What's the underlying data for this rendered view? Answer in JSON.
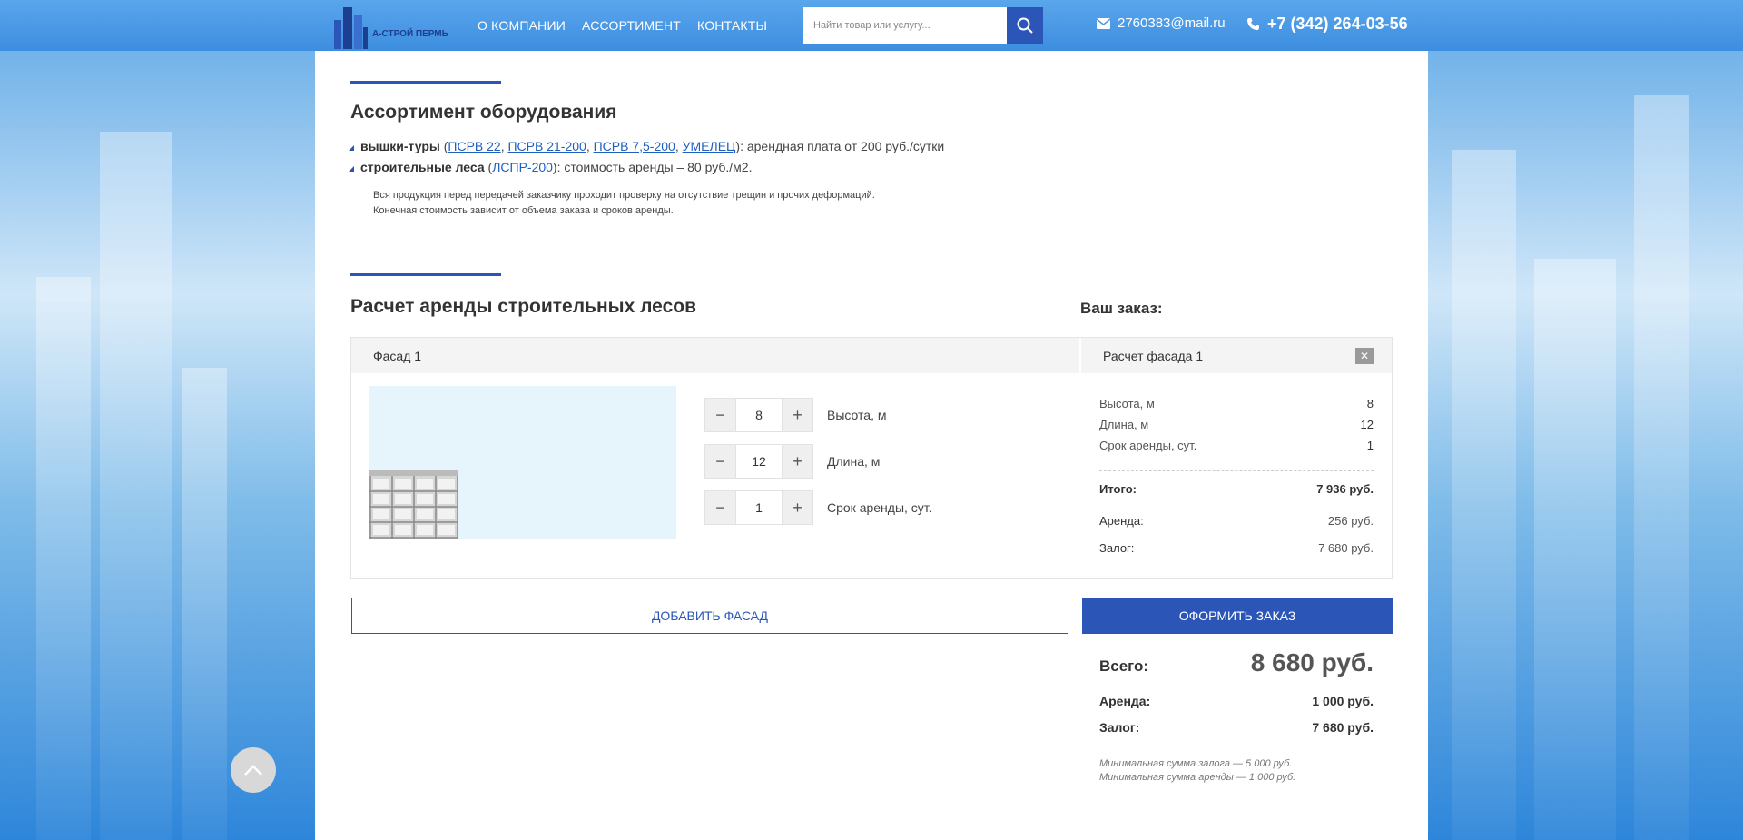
{
  "header": {
    "logo_text": "А-СТРОЙ ПЕРМЬ",
    "nav": [
      "О КОМПАНИИ",
      "АССОРТИМЕНТ",
      "КОНТАКТЫ"
    ],
    "search_placeholder": "Найти товар или услугу...",
    "email": "2760383@mail.ru",
    "phone": "+7 (342) 264-03-56"
  },
  "assortment": {
    "title": "Ассортимент оборудования",
    "item1": {
      "bold": "вышки-туры",
      "open": " (",
      "links": [
        "ПСРВ 22",
        "ПСРВ 21-200",
        "ПСРВ 7,5-200",
        "УМЕЛЕЦ"
      ],
      "sep": ", ",
      "rest": "): арендная плата от 200 руб./сутки"
    },
    "item2": {
      "bold": "строительные леса",
      "open": " (",
      "link": "ЛСПР-200",
      "rest": "): стоимость аренды – 80 руб./м2."
    },
    "note1": "Вся продукция перед передачей заказчику проходит проверку на отсутствие трещин и прочих деформаций.",
    "note2": "Конечная стоимость зависит от объема заказа и сроков аренды."
  },
  "calculator": {
    "title": "Расчет аренды строительных лесов",
    "order_title": "Ваш заказ:",
    "facade_tab": "Фасад 1",
    "order_head": "Расчет фасада 1",
    "close": "✕",
    "inputs": [
      {
        "value": "8",
        "label": "Высота, м"
      },
      {
        "value": "12",
        "label": "Длина, м"
      },
      {
        "value": "1",
        "label": "Срок аренды, сут."
      }
    ],
    "summary": [
      {
        "label": "Высота, м",
        "value": "8"
      },
      {
        "label": "Длина, м",
        "value": "12"
      },
      {
        "label": "Срок аренды, сут.",
        "value": "1"
      }
    ],
    "itogo": {
      "label": "Итого:",
      "value": "7 936 руб."
    },
    "arenda": {
      "label": "Аренда:",
      "value": "256 руб."
    },
    "zalog": {
      "label": "Залог:",
      "value": "7 680 руб."
    },
    "add_button": "ДОБАВИТЬ ФАСАД",
    "order_button": "ОФОРМИТЬ ЗАКАЗ",
    "total": {
      "label": "Всего:",
      "value": "8 680 руб."
    },
    "total_arenda": {
      "label": "Аренда:",
      "value": "1 000 руб."
    },
    "total_zalog": {
      "label": "Залог:",
      "value": "7 680 руб."
    },
    "min_zalog": "Минимальная сумма залога — 5 000 руб.",
    "min_arenda": "Минимальная сумма аренды — 1 000 руб."
  },
  "icons": {
    "search": "search-icon",
    "mail": "envelope-icon",
    "phone": "phone-icon",
    "up": "chevron-up-icon"
  },
  "colors": {
    "accent": "#2b56b8",
    "header": "#4a9be6"
  }
}
